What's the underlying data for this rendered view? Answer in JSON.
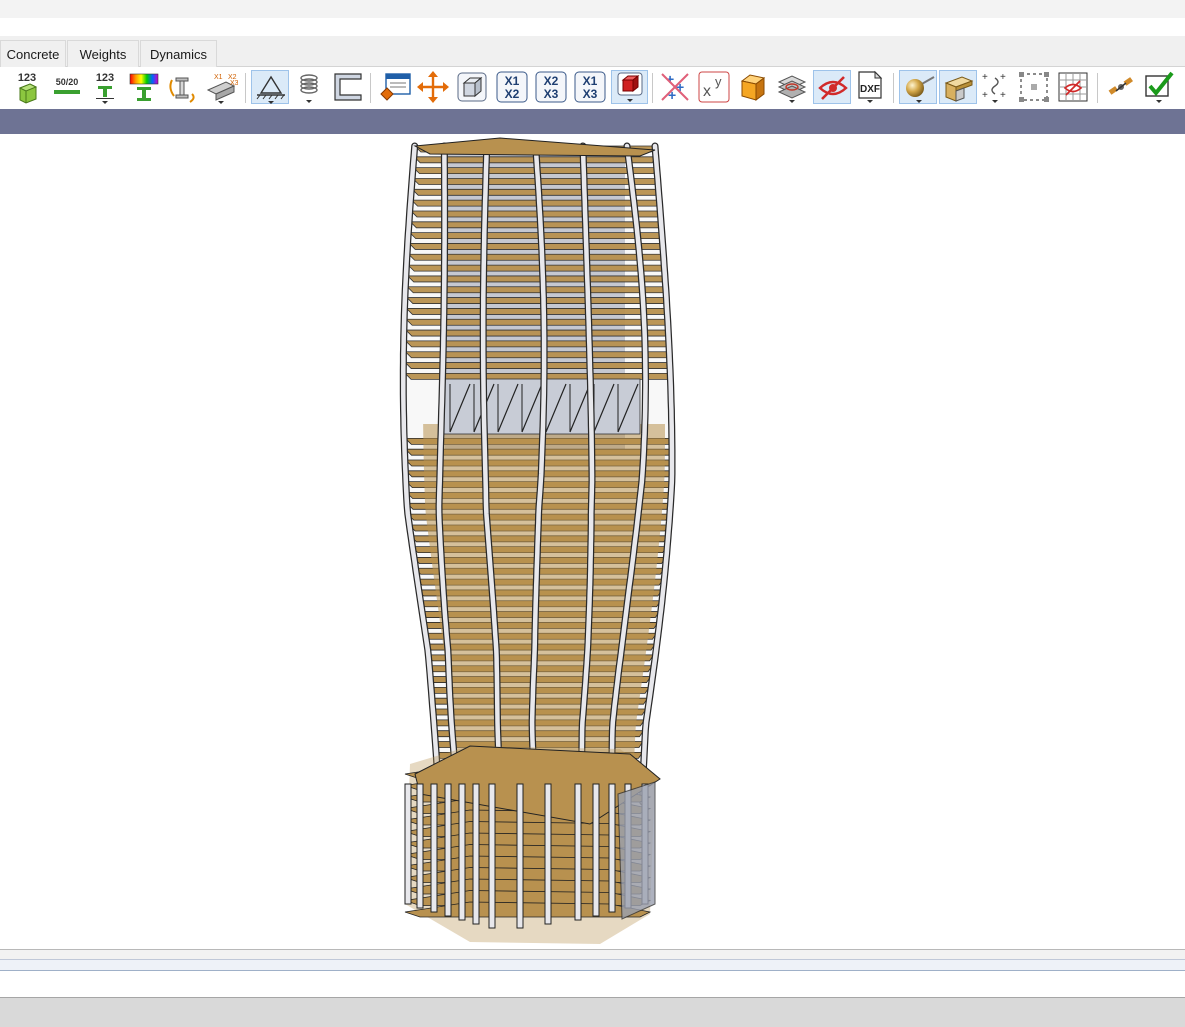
{
  "tabs": [
    {
      "label": "Concrete"
    },
    {
      "label": "Weights"
    },
    {
      "label": "Dynamics"
    }
  ],
  "toolbar": {
    "numbering_label": "123",
    "ratio_label": "50/20",
    "section_numbering_label": "123",
    "axis_x1x2": [
      "X1",
      "X2"
    ],
    "axis_x2x3": [
      "X2",
      "X3"
    ],
    "axis_x1x3": [
      "X1",
      "X3"
    ],
    "local_axes_small": [
      "X1",
      "X2",
      "X3"
    ],
    "coords_x": "x",
    "coords_y": "y",
    "dxf_label": "DXF"
  },
  "colors": {
    "slab": "#b8914f",
    "slab_dark": "#8a6a36",
    "column": "#e8e8ec",
    "core": "#9aa0b0",
    "title_strip": "#6e7394",
    "accent_blue": "#1f5fa8"
  },
  "model": {
    "description_icon": "building-3d-model"
  }
}
